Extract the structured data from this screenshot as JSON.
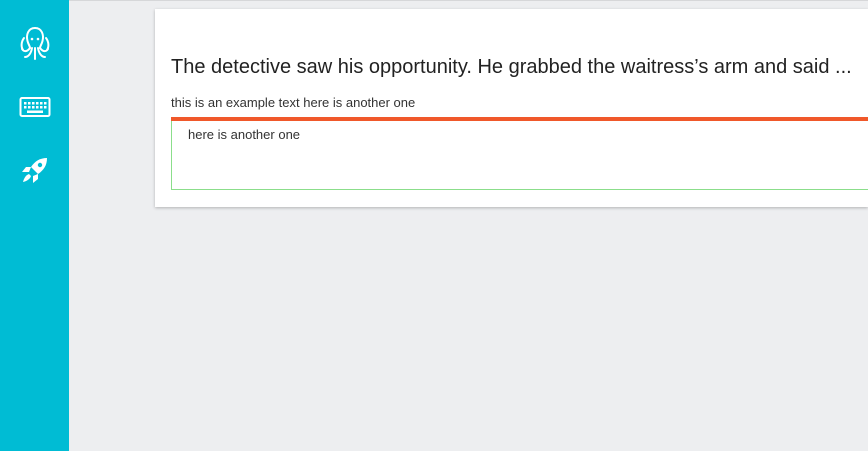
{
  "sidebar": {
    "items": [
      {
        "icon": "squid-logo-icon"
      },
      {
        "icon": "keyboard-icon"
      },
      {
        "icon": "rocket-icon"
      }
    ],
    "background": "#00bcd4"
  },
  "card": {
    "title": "The detective saw his opportunity. He grabbed the waitress’s arm and said ...",
    "example_text": "this is an example text here is another one",
    "answer_text": "here is another one",
    "accent_color": "#f0582a",
    "input_border_color": "#8bde8b"
  }
}
